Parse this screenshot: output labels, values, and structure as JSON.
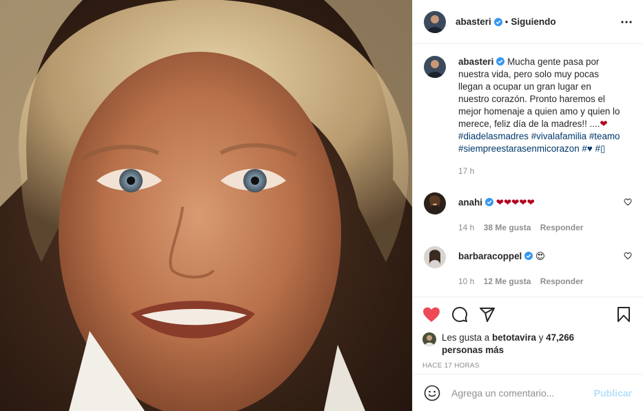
{
  "post": {
    "author": "abasteri",
    "follow_status": "Siguiendo",
    "dot": "•"
  },
  "caption": {
    "username": "abasteri",
    "text": "Mucha gente pasa por nuestra vida, pero solo muy pocas llegan a ocupar un gran lugar en nuestro corazón. Pronto haremos el mejor homenaje a quien amo y quien lo merece, feliz día de la madres!! ....",
    "emoji": "❤",
    "hashtags": [
      "#diadelasmadres",
      "#vivalafamilia",
      "#teamo",
      "#siempreestarasenmicorazon",
      "#♥",
      "#▯"
    ],
    "time": "17 h"
  },
  "comments": [
    {
      "username": "anahi",
      "text": "❤❤❤❤❤",
      "time": "14 h",
      "likes": "38 Me gusta",
      "reply": "Responder"
    },
    {
      "username": "barbaracoppel",
      "text": "😍",
      "time": "10 h",
      "likes": "12 Me gusta",
      "reply": "Responder"
    }
  ],
  "likes": {
    "prefix": "Les gusta a",
    "user": "betotavira",
    "connector": "y",
    "count": "47,266 personas más"
  },
  "timestamp": "Hace 17 horas",
  "add_comment": {
    "placeholder": "Agrega un comentario...",
    "publish_label": "Publicar"
  },
  "icons": {
    "like": "heart-filled-icon",
    "comment": "comment-icon",
    "share": "paper-plane-icon",
    "save": "bookmark-icon",
    "more": "more-options-icon",
    "emoji": "smiley-icon"
  },
  "colors": {
    "like_red": "#ed4956",
    "verified_blue": "#3897f0",
    "link_blue": "#00376b",
    "muted": "#8e8e8e",
    "publish_disabled": "#b2dffc"
  }
}
